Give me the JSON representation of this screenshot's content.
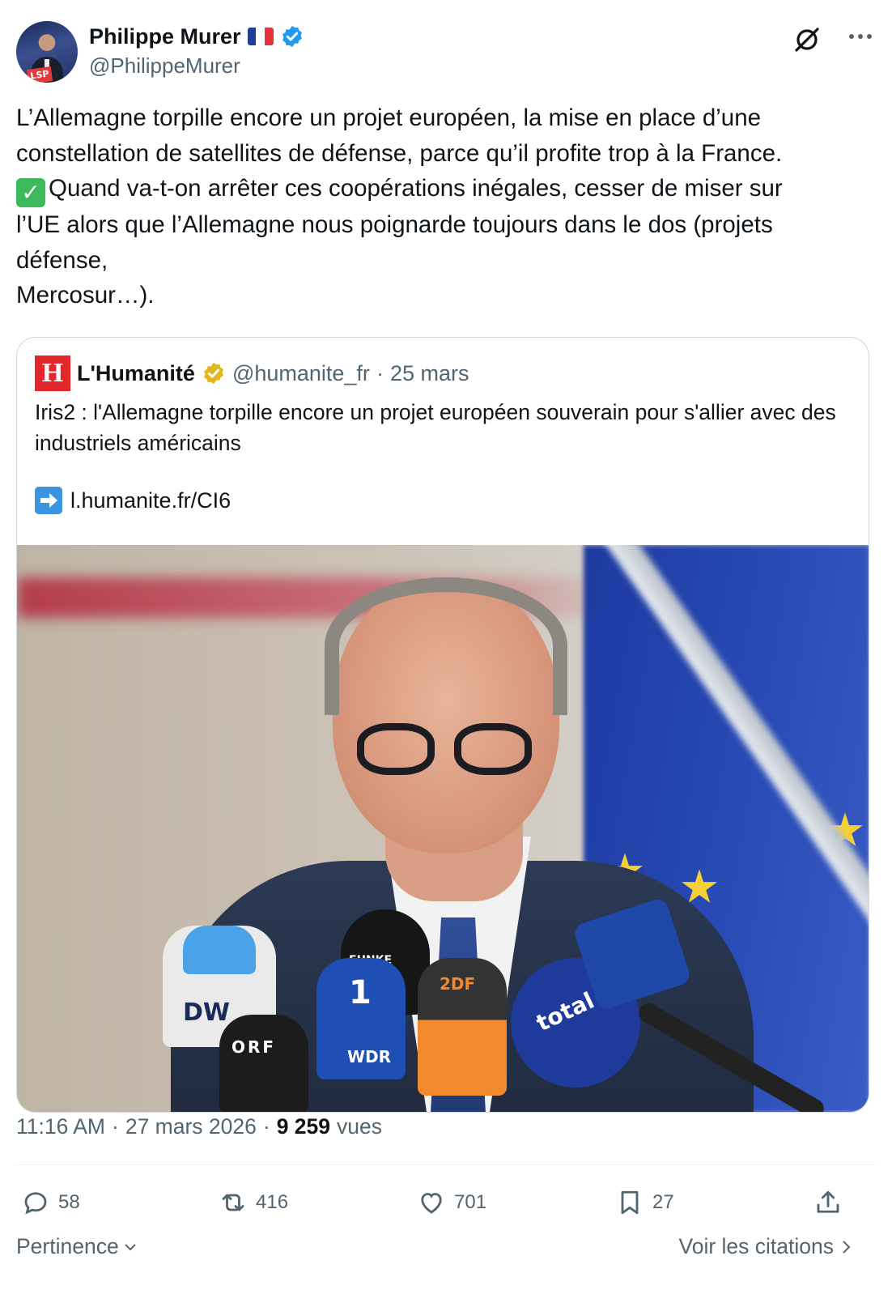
{
  "author": {
    "display_name": "Philippe Murer",
    "handle": "@PhilippeMurer",
    "avatar_tag": "LSP",
    "verified_color": "#1d9bf0"
  },
  "tweet": {
    "text_before_emoji": "L’Allemagne torpille encore un projet européen, la mise en place d’une\nconstellation de satellites de défense, parce qu’il profite trop à la France.\n",
    "text_after_emoji": "Quand va-t-on arrêter ces coopérations inégales, cesser de miser sur\nl’UE alors que l’Allemagne nous poignarde toujours dans le dos (projets\ndéfense,\nMercosur…).",
    "emoji": "check-mark-button"
  },
  "quoted": {
    "logo_letter": "H",
    "name": "L'Humanité",
    "handle": "@humanite_fr",
    "separator": "·",
    "date": "25 mars",
    "text": "Iris2 : l'Allemagne torpille encore un projet européen souverain pour s'allier avec des industriels américains",
    "link": "l.humanite.fr/CI6",
    "mic_labels": {
      "dw": "DW",
      "orf": "ORF",
      "ard": "1",
      "wdr": "WDR",
      "zdf": "2DF",
      "total": "total",
      "funk": "FUNKE"
    }
  },
  "meta": {
    "time": "11:16 AM",
    "dot1": "·",
    "date": "27 mars 2026",
    "dot2": "·",
    "views": "9 259",
    "views_label": "vues"
  },
  "actions": {
    "replies": "58",
    "reposts": "416",
    "likes": "701",
    "bookmarks": "27"
  },
  "footer": {
    "sort_label": "Pertinence",
    "quotes_label": "Voir les citations"
  }
}
